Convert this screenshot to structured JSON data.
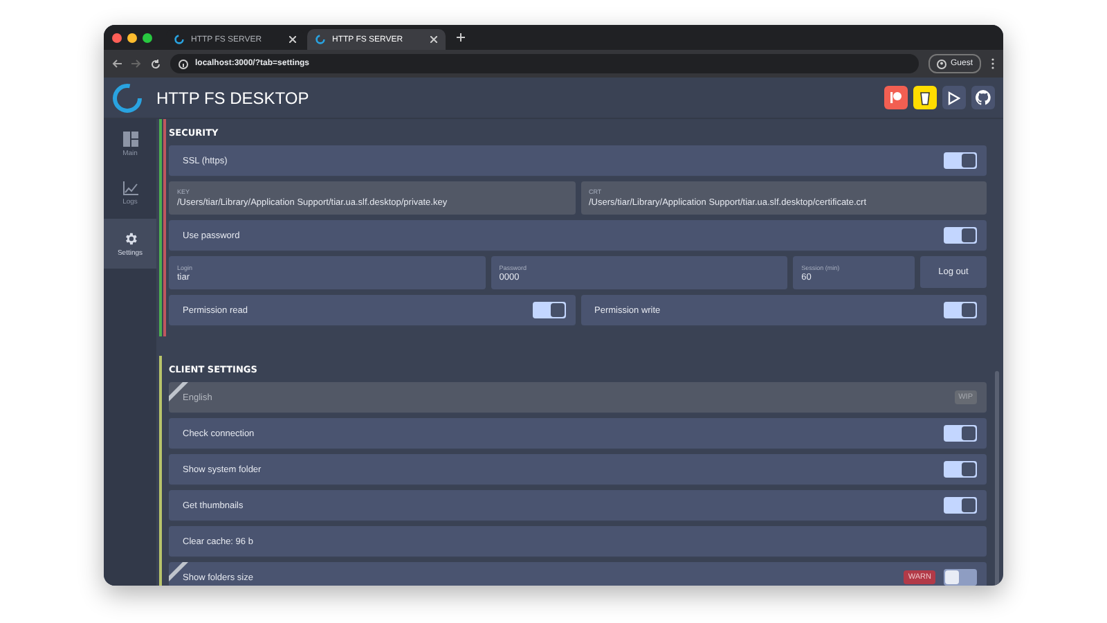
{
  "browser": {
    "tabs": [
      {
        "title": "HTTP FS SERVER",
        "selected": false
      },
      {
        "title": "HTTP FS SERVER",
        "selected": true
      }
    ],
    "url": "localhost:3000/?tab=settings",
    "profile": "Guest"
  },
  "app": {
    "title": "HTTP FS DESKTOP"
  },
  "sidebar": {
    "items": [
      {
        "label": "Main",
        "kind": "main",
        "selected": false
      },
      {
        "label": "Logs",
        "kind": "logs",
        "selected": false
      },
      {
        "label": "Settings",
        "kind": "settings",
        "selected": true
      }
    ]
  },
  "security": {
    "title": "SECURITY",
    "rows": [
      {
        "kind": "toggle",
        "label": "SSL (https)",
        "on": true
      },
      {
        "kind": "fields",
        "fields": [
          {
            "label": "KEY",
            "value": "/Users/tiar/Library/Application Support/tiar.ua.slf.desktop/private.key"
          },
          {
            "label": "CRT",
            "value": "/Users/tiar/Library/Application Support/tiar.ua.slf.desktop/certificate.crt"
          }
        ]
      },
      {
        "kind": "toggle",
        "label": "Use password",
        "on": true
      },
      {
        "kind": "login",
        "fields": [
          {
            "label": "Login",
            "value": "tiar"
          },
          {
            "label": "Password",
            "value": "0000"
          },
          {
            "label": "Session (min)",
            "value": "60"
          }
        ],
        "button": "Log out"
      },
      {
        "kind": "pair",
        "items": [
          {
            "label": "Permission read",
            "on": true
          },
          {
            "label": "Permission write",
            "on": true
          }
        ]
      }
    ]
  },
  "client": {
    "title": "CLIENT SETTINGS",
    "rows": [
      {
        "kind": "select",
        "label": "English",
        "badge": "WIP",
        "disabled": true,
        "ribbon": true
      },
      {
        "kind": "toggle",
        "label": "Check connection",
        "on": true,
        "ribbon": false
      },
      {
        "kind": "toggle",
        "label": "Show system folder",
        "on": true,
        "ribbon": false
      },
      {
        "kind": "toggle",
        "label": "Get thumbnails",
        "on": true,
        "ribbon": false
      },
      {
        "kind": "action",
        "label": "Clear cache: 96 b",
        "ribbon": false
      },
      {
        "kind": "toggle",
        "label": "Show folders size",
        "on": false,
        "warn": "WARN",
        "ribbon": true
      }
    ]
  }
}
